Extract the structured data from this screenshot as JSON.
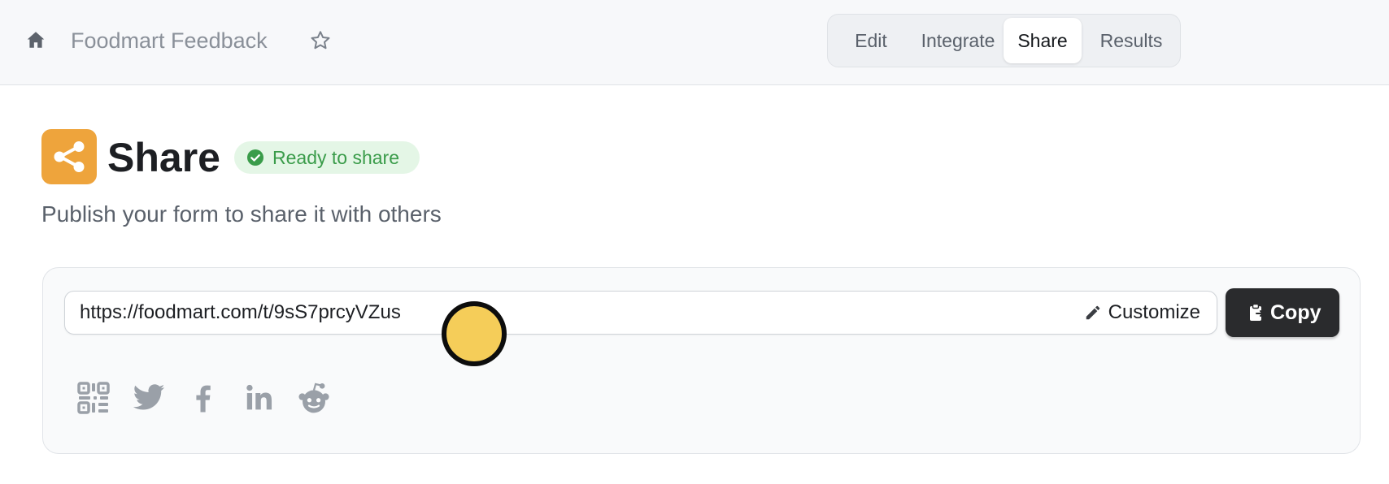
{
  "header": {
    "home_icon": "home-icon",
    "form_title": "Foodmart Feedback",
    "favorite_icon": "star-icon",
    "tabs": [
      {
        "label": "Edit",
        "active": false
      },
      {
        "label": "Integrate",
        "active": false
      },
      {
        "label": "Share",
        "active": true
      },
      {
        "label": "Results",
        "active": false
      }
    ]
  },
  "page": {
    "title": "Share",
    "title_icon": "share-icon",
    "status": "Ready to share",
    "subtitle": "Publish your form to share it with others"
  },
  "share_link": {
    "url": "https://foodmart.com/t/9sS7prcyVZus",
    "customize_label": "Customize",
    "copy_label": "Copy"
  },
  "social": [
    "qr-code-icon",
    "twitter-icon",
    "facebook-icon",
    "linkedin-icon",
    "reddit-icon"
  ],
  "colors": {
    "accent": "#eea43c",
    "status_green": "#3a9c4a",
    "status_bg": "#e4f6e6",
    "copy_button": "#2a2b2d",
    "cursor": "#f5cd59"
  }
}
